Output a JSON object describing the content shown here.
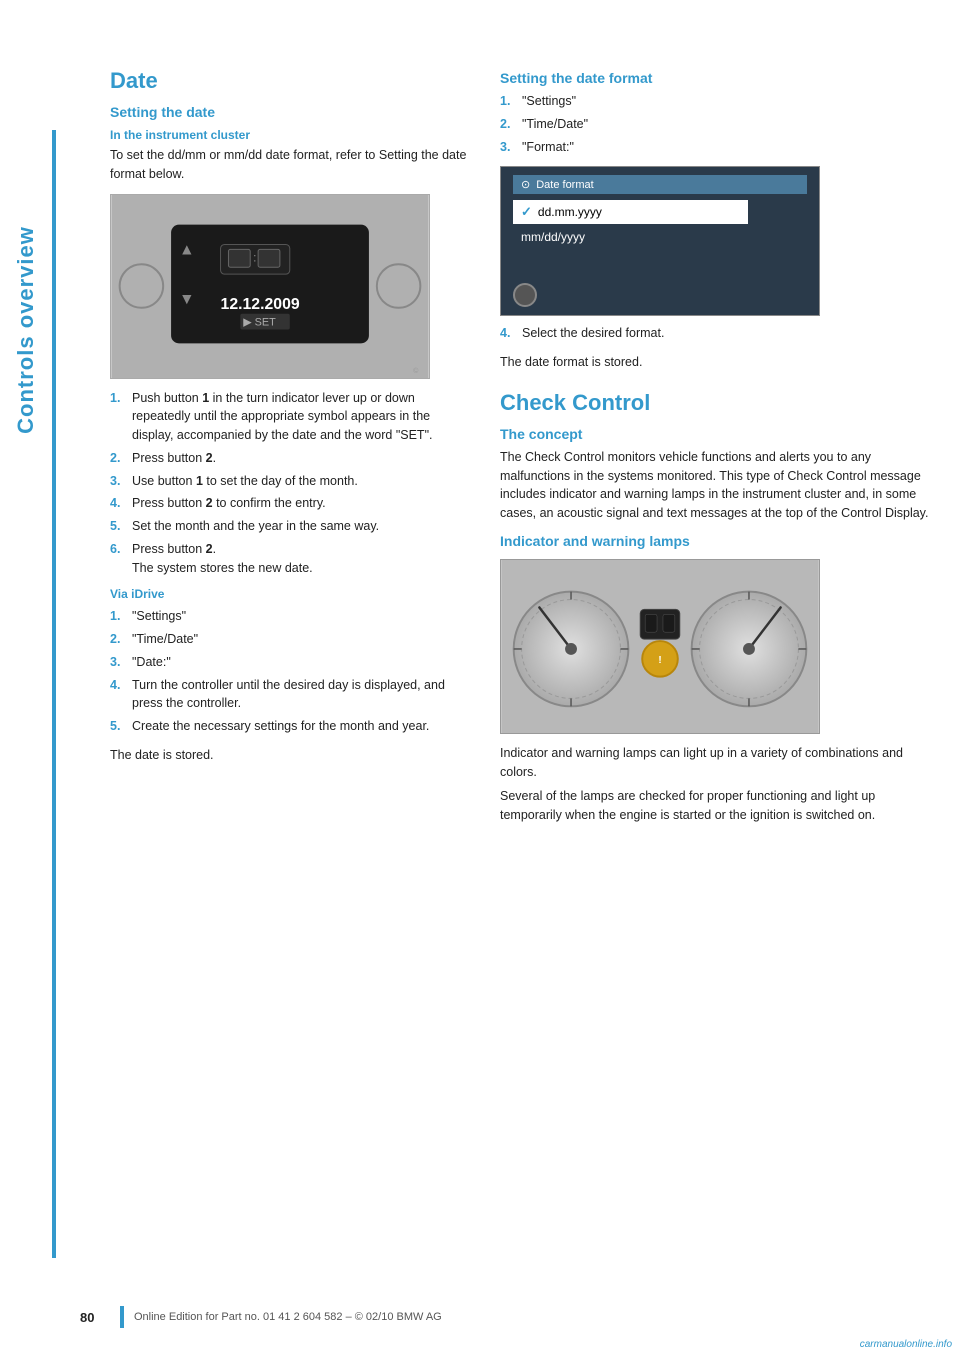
{
  "sidebar": {
    "label": "Controls overview"
  },
  "page_number": "80",
  "footer_text": "Online Edition for Part no. 01 41 2 604 582 – © 02/10 BMW AG",
  "left_column": {
    "section_title": "Date",
    "subsection_setting_date": "Setting the date",
    "sub_subsection_instrument_cluster": "In the instrument cluster",
    "instrument_cluster_intro": "To set the dd/mm or mm/dd date format, refer to Setting the date format below.",
    "instrument_steps": [
      {
        "num": "1.",
        "text": "Push button ",
        "bold": "1",
        "text2": " in the turn indicator lever up or down repeatedly until the appropriate symbol appears in the display, accompanied by the date and the word \"SET\"."
      },
      {
        "num": "2.",
        "text": "Press button ",
        "bold": "2",
        "text2": "."
      },
      {
        "num": "3.",
        "text": "Use button ",
        "bold": "1",
        "text2": " to set the day of the month."
      },
      {
        "num": "4.",
        "text": "Press button ",
        "bold": "2",
        "text2": " to confirm the entry."
      },
      {
        "num": "5.",
        "text": "Set the month and the year in the same way."
      },
      {
        "num": "6.",
        "text": "Press button ",
        "bold": "2",
        "text2": ".",
        "sub": "The system stores the new date."
      }
    ],
    "via_idrive_title": "Via iDrive",
    "via_idrive_steps": [
      {
        "num": "1.",
        "text": "\"Settings\""
      },
      {
        "num": "2.",
        "text": "\"Time/Date\""
      },
      {
        "num": "3.",
        "text": "\"Date:\""
      },
      {
        "num": "4.",
        "text": "Turn the controller until the desired day is displayed, and press the controller."
      },
      {
        "num": "5.",
        "text": "Create the necessary settings for the month and year."
      }
    ],
    "date_stored_text": "The date is stored."
  },
  "right_column": {
    "setting_date_format_title": "Setting the date format",
    "date_format_steps": [
      {
        "num": "1.",
        "text": "\"Settings\""
      },
      {
        "num": "2.",
        "text": "\"Time/Date\""
      },
      {
        "num": "3.",
        "text": "\"Format:\""
      }
    ],
    "date_format_screen": {
      "title_icon": "⊙",
      "title_text": "Date format",
      "option1": "✓ dd.mm.yyyy",
      "option2": "mm/dd/yyyy"
    },
    "step4": "Select the desired format.",
    "date_format_stored": "The date format is stored.",
    "check_control_title": "Check Control",
    "concept_title": "The concept",
    "concept_text": "The Check Control monitors vehicle functions and alerts you to any malfunctions in the systems monitored. This type of Check Control message includes indicator and warning lamps in the instrument cluster and, in some cases, an acoustic signal and text messages at the top of the Control Display.",
    "indicator_lamps_title": "Indicator and warning lamps",
    "indicator_text1": "Indicator and warning lamps can light up in a variety of combinations and colors.",
    "indicator_text2": "Several of the lamps are checked for proper functioning and light up temporarily when the engine is started or the ignition is switched on."
  },
  "watermark": "carmanualonline.info"
}
